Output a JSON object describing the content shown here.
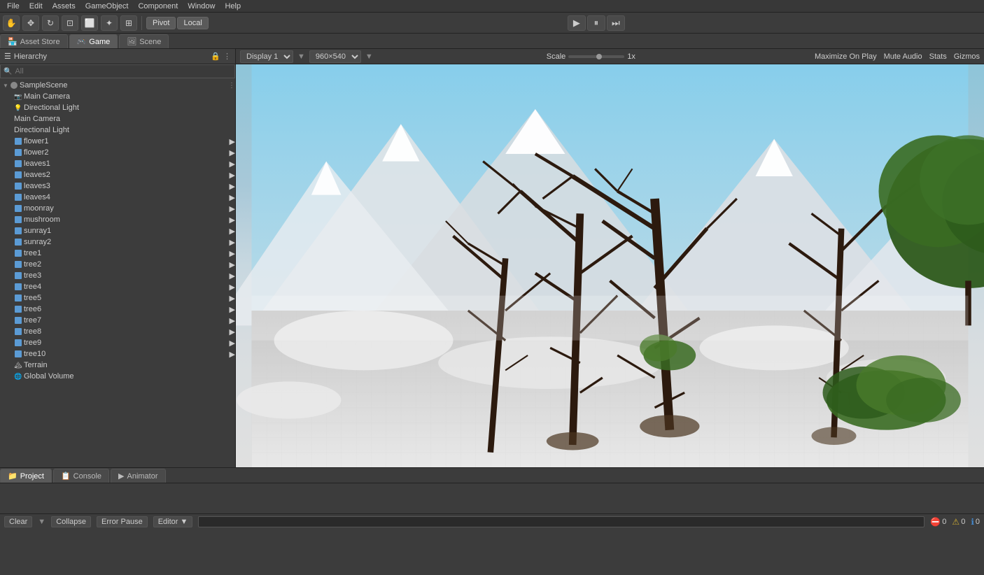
{
  "menubar": {
    "items": [
      "File",
      "Edit",
      "Assets",
      "GameObject",
      "Component",
      "Window",
      "Help"
    ]
  },
  "toolbar": {
    "pivot_label": "Pivot",
    "local_label": "Local",
    "play_button": "▶",
    "pause_button": "⏸",
    "step_button": "⏭"
  },
  "tabs": {
    "asset_store": "Asset Store",
    "game": "Game",
    "scene": "Scene"
  },
  "display_bar": {
    "display": "Display 1",
    "resolution": "960×540",
    "scale_label": "Scale",
    "scale_value": "1x"
  },
  "game_labels": {
    "maximize_on_play": "Maximize On Play",
    "mute_audio": "Mute Audio",
    "stats": "Stats",
    "gizmos": "Gizmos"
  },
  "hierarchy": {
    "title": "Hierarchy",
    "search_placeholder": "All",
    "scene_name": "SampleScene",
    "items": [
      {
        "label": "Main Camera",
        "type": "camera",
        "depth": 1
      },
      {
        "label": "Directional Light",
        "type": "light",
        "depth": 1
      },
      {
        "label": "flower1",
        "type": "cube",
        "depth": 1,
        "has_children": true
      },
      {
        "label": "flower2",
        "type": "cube",
        "depth": 1,
        "has_children": true
      },
      {
        "label": "leaves1",
        "type": "cube",
        "depth": 1,
        "has_children": true
      },
      {
        "label": "leaves2",
        "type": "cube",
        "depth": 1,
        "has_children": true
      },
      {
        "label": "leaves3",
        "type": "cube",
        "depth": 1,
        "has_children": true
      },
      {
        "label": "leaves4",
        "type": "cube",
        "depth": 1,
        "has_children": true
      },
      {
        "label": "moonray",
        "type": "cube",
        "depth": 1,
        "has_children": true
      },
      {
        "label": "mushroom",
        "type": "cube",
        "depth": 1,
        "has_children": true
      },
      {
        "label": "sunray1",
        "type": "cube",
        "depth": 1,
        "has_children": true
      },
      {
        "label": "sunray2",
        "type": "cube",
        "depth": 1,
        "has_children": true
      },
      {
        "label": "tree1",
        "type": "cube",
        "depth": 1,
        "has_children": true
      },
      {
        "label": "tree2",
        "type": "cube",
        "depth": 1,
        "has_children": true
      },
      {
        "label": "tree3",
        "type": "cube",
        "depth": 1,
        "has_children": true
      },
      {
        "label": "tree4",
        "type": "cube",
        "depth": 1,
        "has_children": true
      },
      {
        "label": "tree5",
        "type": "cube",
        "depth": 1,
        "has_children": true
      },
      {
        "label": "tree6",
        "type": "cube",
        "depth": 1,
        "has_children": true
      },
      {
        "label": "tree7",
        "type": "cube",
        "depth": 1,
        "has_children": true
      },
      {
        "label": "tree8",
        "type": "cube",
        "depth": 1,
        "has_children": true
      },
      {
        "label": "tree9",
        "type": "cube",
        "depth": 1,
        "has_children": true
      },
      {
        "label": "tree10",
        "type": "cube",
        "depth": 1,
        "has_children": true
      },
      {
        "label": "Terrain",
        "type": "terrain",
        "depth": 1
      },
      {
        "label": "Global Volume",
        "type": "volume",
        "depth": 1
      }
    ]
  },
  "bottom_tabs": {
    "project": "Project",
    "console": "Console",
    "animator": "Animator"
  },
  "bottom_bar": {
    "clear_label": "Clear",
    "collapse_label": "Collapse",
    "error_pause_label": "Error Pause",
    "editor_label": "Editor",
    "error_count": "0",
    "warning_count": "0",
    "info_count": "0"
  }
}
